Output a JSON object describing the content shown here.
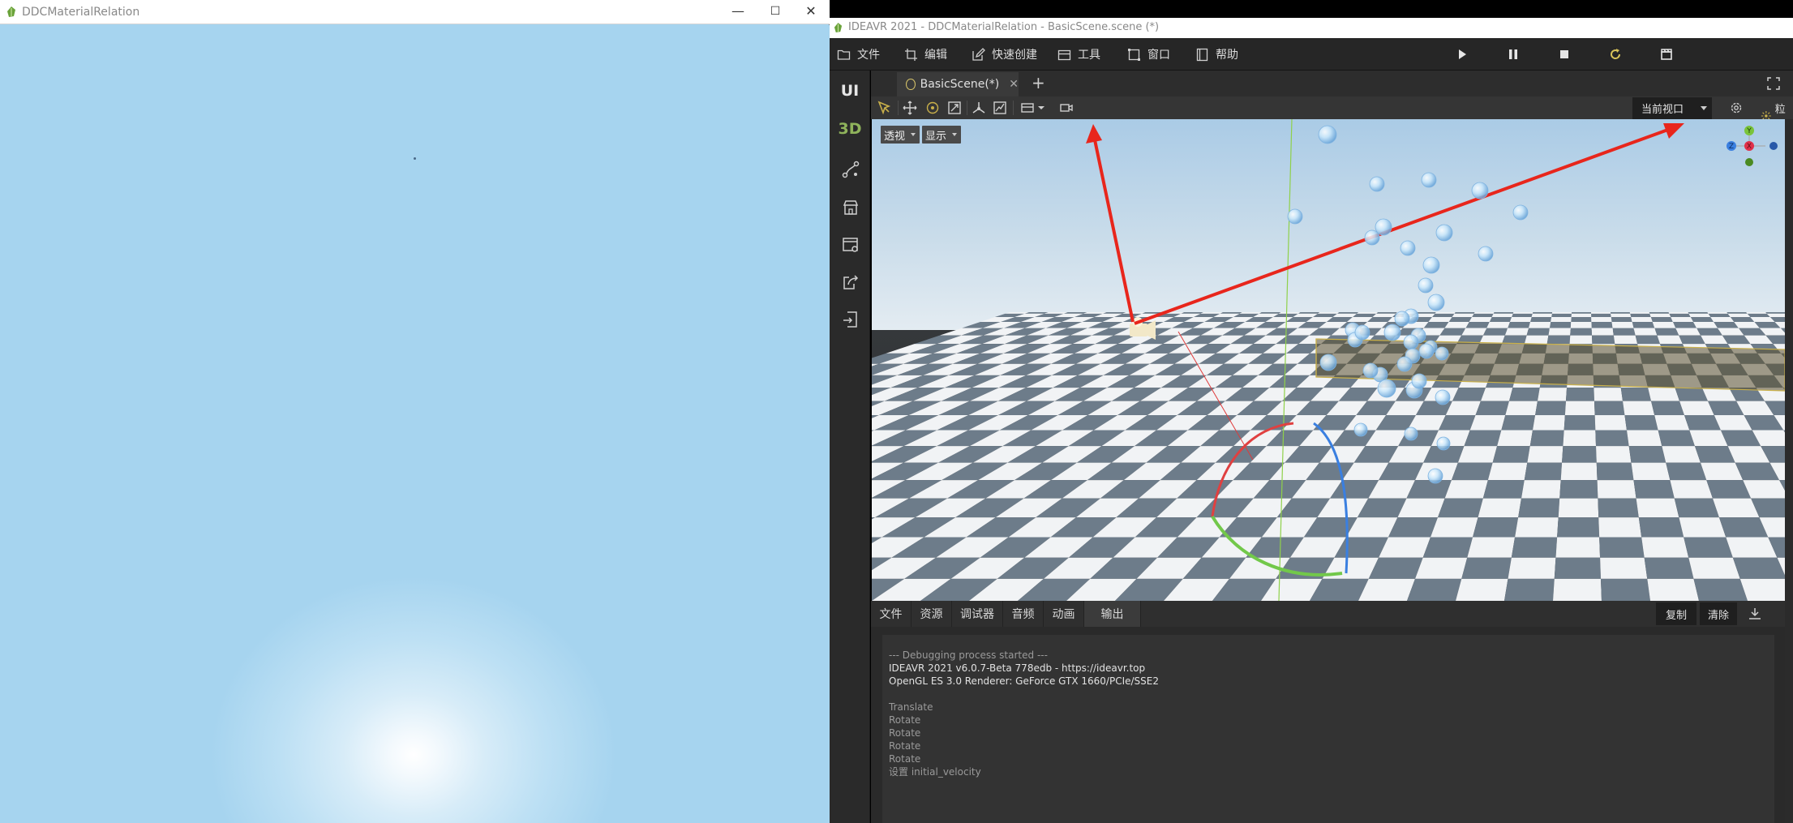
{
  "left_window": {
    "title": "DDCMaterialRelation",
    "controls": {
      "minimize": "—",
      "maximize": "☐",
      "close": "✕"
    }
  },
  "ide": {
    "title": "IDEAVR 2021 - DDCMaterialRelation - BasicScene.scene (*)",
    "menu": [
      {
        "label": "文件",
        "icon": "folder-icon"
      },
      {
        "label": "编辑",
        "icon": "crop-icon"
      },
      {
        "label": "快速创建",
        "icon": "edit-icon"
      },
      {
        "label": "工具",
        "icon": "toolbox-icon"
      },
      {
        "label": "窗口",
        "icon": "window-icon"
      },
      {
        "label": "帮助",
        "icon": "help-book-icon"
      }
    ],
    "playback": [
      "play-icon",
      "pause-icon",
      "stop-icon",
      "reload-icon",
      "clapperboard-icon"
    ],
    "sidebar": {
      "ui_label": "UI",
      "three_d_label": "3D"
    },
    "scene_tab": {
      "label": "BasicScene(*)",
      "close": "✕",
      "add": "+"
    },
    "toolbar": {
      "viewport_label": "当前视口",
      "particle_label": "粒子"
    },
    "viewport": {
      "perspective_label": "透视",
      "display_label": "显示",
      "gizmo_axes": {
        "y": "Y",
        "z": "Z",
        "x": "X"
      }
    },
    "bottom": {
      "tabs": [
        "文件",
        "资源",
        "调试器",
        "音频",
        "动画",
        "输出"
      ],
      "active_tab": "输出",
      "copy_label": "复制",
      "clear_label": "清除",
      "console": {
        "line1": "--- Debugging process started ---",
        "line2": "IDEAVR 2021 v6.0.7-Beta 778edb - https://ideavr.top",
        "line3": "OpenGL ES 3.0 Renderer: GeForce GTX 1660/PCIe/SSE2",
        "line4": "",
        "line5": "Translate",
        "line6": "Rotate",
        "line7": "Rotate",
        "line8": "Rotate",
        "line9": "Rotate",
        "line10": "设置 initial_velocity"
      }
    },
    "colors": {
      "accent_green": "#8fb35b",
      "annotation_red": "#e8261c",
      "sky_blue": "#a6d4ef"
    }
  }
}
